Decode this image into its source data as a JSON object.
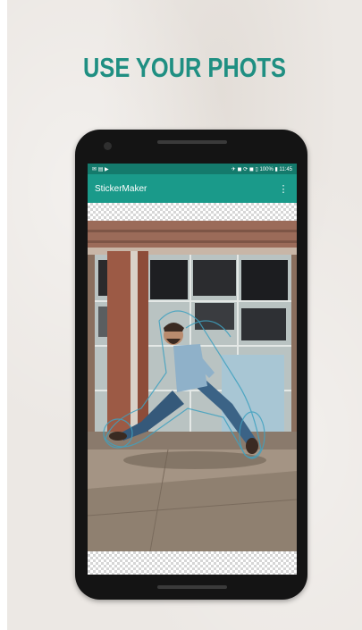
{
  "promo": {
    "headline": "USE YOUR PHOTS",
    "accent_color": "#1f8f82"
  },
  "statusbar": {
    "left_icons": "✉ ▤ ▶",
    "right_text": "✈ ◼ ⟳ ◼ ▯ 100% ▮ 11:45"
  },
  "appbar": {
    "title": "StickerMaker",
    "menu_icon": "overflow-menu-icon",
    "menu_glyph": "⋮",
    "color": "#1a9a8a"
  },
  "editor": {
    "transparency": "checkerboard",
    "image": "photo-of-man-jumping-in-front-of-broken-windows"
  }
}
